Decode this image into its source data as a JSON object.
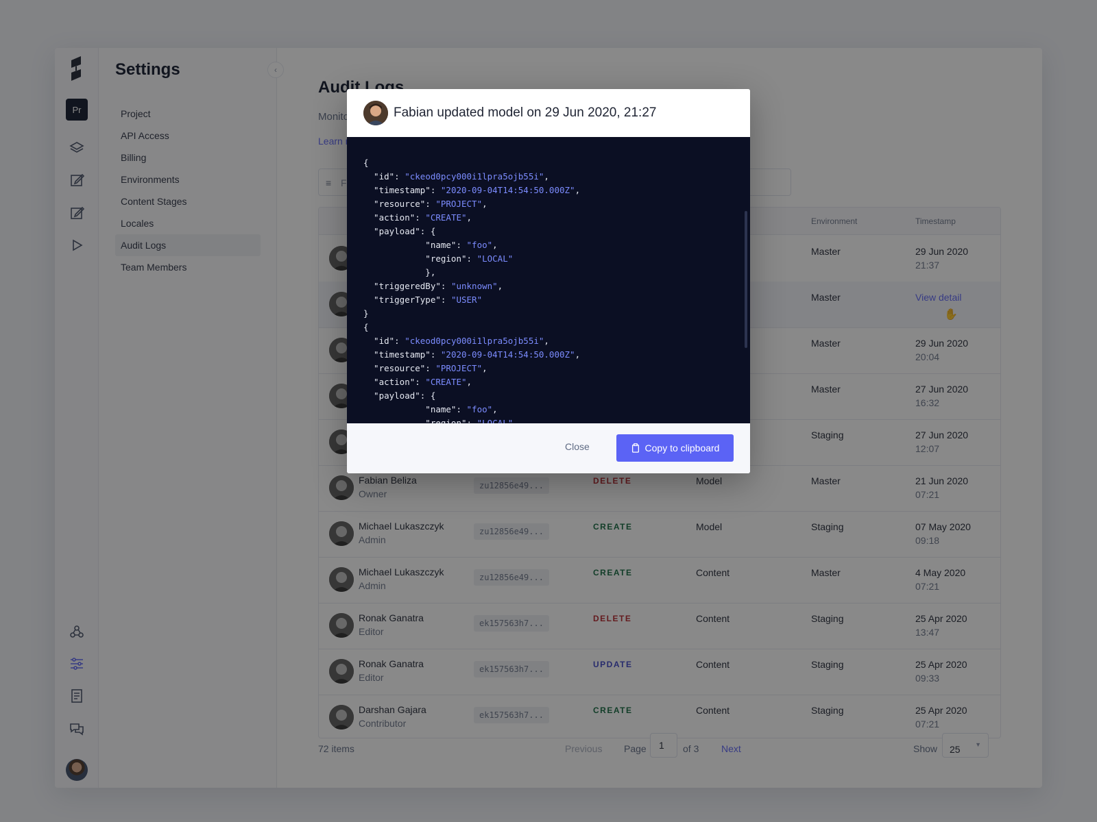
{
  "settings": {
    "title": "Settings",
    "project_badge": "Pr",
    "nav": [
      {
        "label": "Project"
      },
      {
        "label": "API Access"
      },
      {
        "label": "Billing"
      },
      {
        "label": "Environments"
      },
      {
        "label": "Content Stages"
      },
      {
        "label": "Locales"
      },
      {
        "label": "Audit Logs",
        "active": true
      },
      {
        "label": "Team Members"
      }
    ]
  },
  "rail_icons": [
    "logo-icon",
    "layers-icon",
    "edit-icon",
    "edit-icon",
    "play-icon",
    "webhook-icon",
    "sliders-icon",
    "docs-icon",
    "chat-icon"
  ],
  "page": {
    "title": "Audit Logs",
    "subtitle": "Monito",
    "learn_link": "Learn m",
    "filter_placeholder": "Fi"
  },
  "table": {
    "columns": [
      "Environment",
      "Timestamp"
    ],
    "rows": [
      {
        "name": "",
        "role": "",
        "id": "",
        "action": "",
        "resource": "",
        "environment": "Master",
        "date": "29 Jun 2020",
        "time": "21:37"
      },
      {
        "name": "",
        "role": "",
        "id": "",
        "action": "",
        "resource": "",
        "environment": "Master",
        "date": "",
        "time": "",
        "link": "View detail"
      },
      {
        "name": "",
        "role": "",
        "id": "",
        "action": "",
        "resource": "",
        "environment": "Master",
        "date": "29 Jun 2020",
        "time": "20:04"
      },
      {
        "name": "",
        "role": "",
        "id": "",
        "action": "",
        "resource": "",
        "environment": "Master",
        "date": "27 Jun 2020",
        "time": "16:32"
      },
      {
        "name": "",
        "role": "",
        "id": "",
        "action": "",
        "resource": "",
        "environment": "Staging",
        "date": "27 Jun 2020",
        "time": "12:07"
      },
      {
        "name": "Fabian Beliza",
        "role": "Owner",
        "id": "zu12856e49...",
        "action": "DELETE",
        "resource": "Model",
        "environment": "Master",
        "date": "21 Jun 2020",
        "time": "07:21"
      },
      {
        "name": "Michael Lukaszczyk",
        "role": "Admin",
        "id": "zu12856e49...",
        "action": "CREATE",
        "resource": "Model",
        "environment": "Staging",
        "date": "07 May 2020",
        "time": "09:18"
      },
      {
        "name": "Michael Lukaszczyk",
        "role": "Admin",
        "id": "zu12856e49...",
        "action": "CREATE",
        "resource": "Content",
        "environment": "Master",
        "date": "4 May 2020",
        "time": "07:21"
      },
      {
        "name": "Ronak Ganatra",
        "role": "Editor",
        "id": "ek157563h7...",
        "action": "DELETE",
        "resource": "Content",
        "environment": "Staging",
        "date": "25 Apr 2020",
        "time": "13:47"
      },
      {
        "name": "Ronak Ganatra",
        "role": "Editor",
        "id": "ek157563h7...",
        "action": "UPDATE",
        "resource": "Content",
        "environment": "Staging",
        "date": "25 Apr 2020",
        "time": "09:33"
      },
      {
        "name": "Darshan Gajara",
        "role": "Contributor",
        "id": "ek157563h7...",
        "action": "CREATE",
        "resource": "Content",
        "environment": "Staging",
        "date": "25 Apr 2020",
        "time": "07:21"
      }
    ]
  },
  "action_colors": {
    "DELETE": "#b4232a",
    "CREATE": "#12693f",
    "UPDATE": "#3c44c7"
  },
  "pagination": {
    "total": "72 items",
    "previous": "Previous",
    "page_label": "Page",
    "page": "1",
    "of": "of 3",
    "next": "Next",
    "show_label": "Show",
    "show_value": "25"
  },
  "modal": {
    "title": "Fabian updated model on 29 Jun 2020, 21:27",
    "code_lines": [
      "{",
      "  \"id\": \"ckeod0pcy000i1lpra5ojb55i\",",
      "  \"timestamp\": \"2020-09-04T14:54:50.000Z\",",
      "  \"resource\": \"PROJECT\",",
      "  \"action\": \"CREATE\",",
      "  \"payload\": {",
      "            \"name\": \"foo\",",
      "            \"region\": \"LOCAL\"",
      "            },",
      "  \"triggeredBy\": \"unknown\",",
      "  \"triggerType\": \"USER\"",
      "}",
      "{",
      "  \"id\": \"ckeod0pcy000i1lpra5ojb55i\",",
      "  \"timestamp\": \"2020-09-04T14:54:50.000Z\",",
      "  \"resource\": \"PROJECT\",",
      "  \"action\": \"CREATE\",",
      "  \"payload\": {",
      "            \"name\": \"foo\",",
      "            \"region\": \"LOCAL\""
    ],
    "close_label": "Close",
    "copy_label": "Copy to clipboard"
  }
}
